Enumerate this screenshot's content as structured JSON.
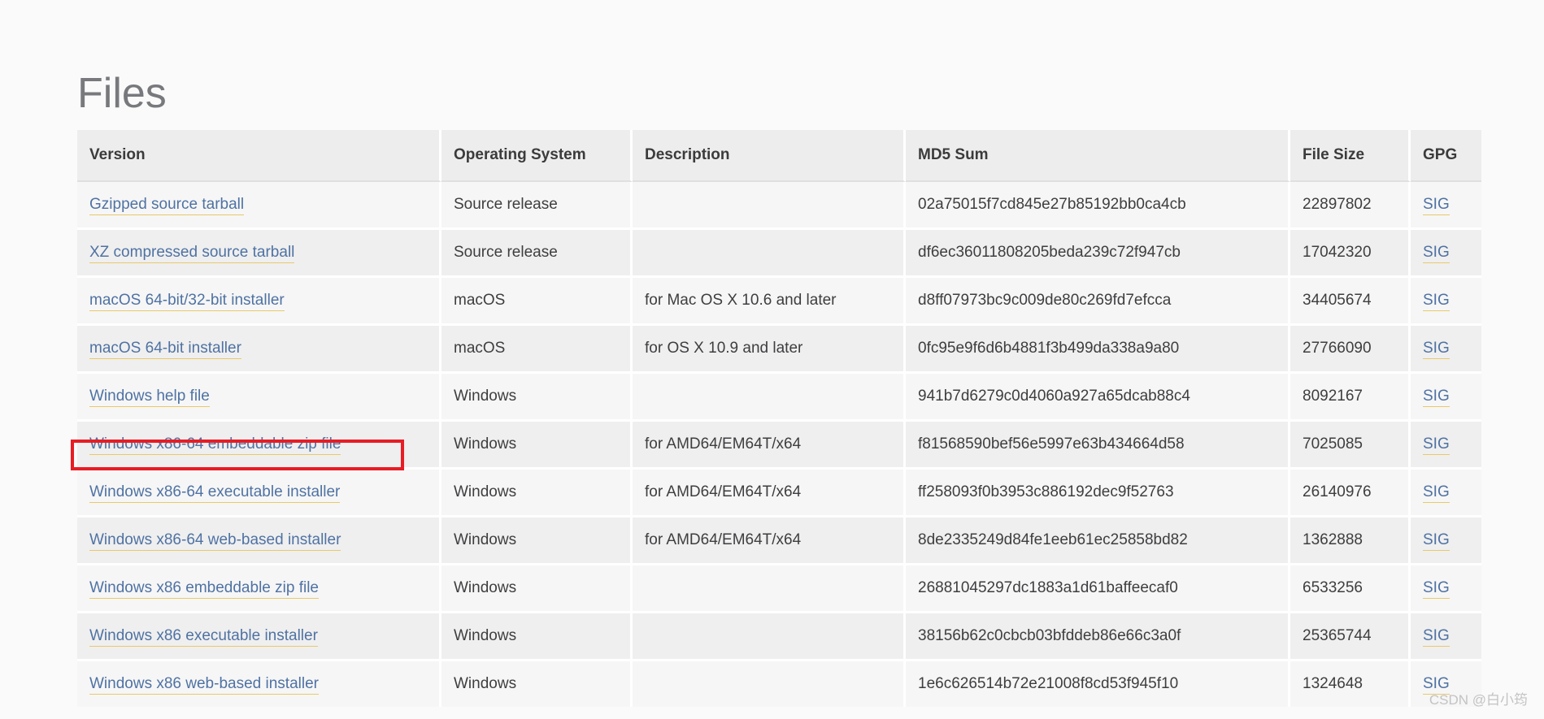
{
  "page": {
    "title": "Files",
    "background_color": "#fafafa",
    "link_color": "#4f72a3",
    "link_underline_color": "#e8c96a",
    "highlight_color": "#e81c24",
    "header_bg": "#ededed"
  },
  "table": {
    "columns": [
      "Version",
      "Operating System",
      "Description",
      "MD5 Sum",
      "File Size",
      "GPG"
    ],
    "rows": [
      {
        "version": "Gzipped source tarball",
        "os": "Source release",
        "description": "",
        "md5": "02a75015f7cd845e27b85192bb0ca4cb",
        "size": "22897802",
        "gpg": "SIG",
        "highlighted": false
      },
      {
        "version": "XZ compressed source tarball",
        "os": "Source release",
        "description": "",
        "md5": "df6ec36011808205beda239c72f947cb",
        "size": "17042320",
        "gpg": "SIG",
        "highlighted": false
      },
      {
        "version": "macOS 64-bit/32-bit installer",
        "os": "macOS",
        "description": "for Mac OS X 10.6 and later",
        "md5": "d8ff07973bc9c009de80c269fd7efcca",
        "size": "34405674",
        "gpg": "SIG",
        "highlighted": false
      },
      {
        "version": "macOS 64-bit installer",
        "os": "macOS",
        "description": "for OS X 10.9 and later",
        "md5": "0fc95e9f6d6b4881f3b499da338a9a80",
        "size": "27766090",
        "gpg": "SIG",
        "highlighted": false
      },
      {
        "version": "Windows help file",
        "os": "Windows",
        "description": "",
        "md5": "941b7d6279c0d4060a927a65dcab88c4",
        "size": "8092167",
        "gpg": "SIG",
        "highlighted": false
      },
      {
        "version": "Windows x86-64 embeddable zip file",
        "os": "Windows",
        "description": "for AMD64/EM64T/x64",
        "md5": "f81568590bef56e5997e63b434664d58",
        "size": "7025085",
        "gpg": "SIG",
        "highlighted": false
      },
      {
        "version": "Windows x86-64 executable installer",
        "os": "Windows",
        "description": "for AMD64/EM64T/x64",
        "md5": "ff258093f0b3953c886192dec9f52763",
        "size": "26140976",
        "gpg": "SIG",
        "highlighted": true
      },
      {
        "version": "Windows x86-64 web-based installer",
        "os": "Windows",
        "description": "for AMD64/EM64T/x64",
        "md5": "8de2335249d84fe1eeb61ec25858bd82",
        "size": "1362888",
        "gpg": "SIG",
        "highlighted": false
      },
      {
        "version": "Windows x86 embeddable zip file",
        "os": "Windows",
        "description": "",
        "md5": "26881045297dc1883a1d61baffeecaf0",
        "size": "6533256",
        "gpg": "SIG",
        "highlighted": false
      },
      {
        "version": "Windows x86 executable installer",
        "os": "Windows",
        "description": "",
        "md5": "38156b62c0cbcb03bfddeb86e66c3a0f",
        "size": "25365744",
        "gpg": "SIG",
        "highlighted": false
      },
      {
        "version": "Windows x86 web-based installer",
        "os": "Windows",
        "description": "",
        "md5": "1e6c626514b72e21008f8cd53f945f10",
        "size": "1324648",
        "gpg": "SIG",
        "highlighted": false
      }
    ]
  },
  "watermark": "CSDN @白小筠"
}
